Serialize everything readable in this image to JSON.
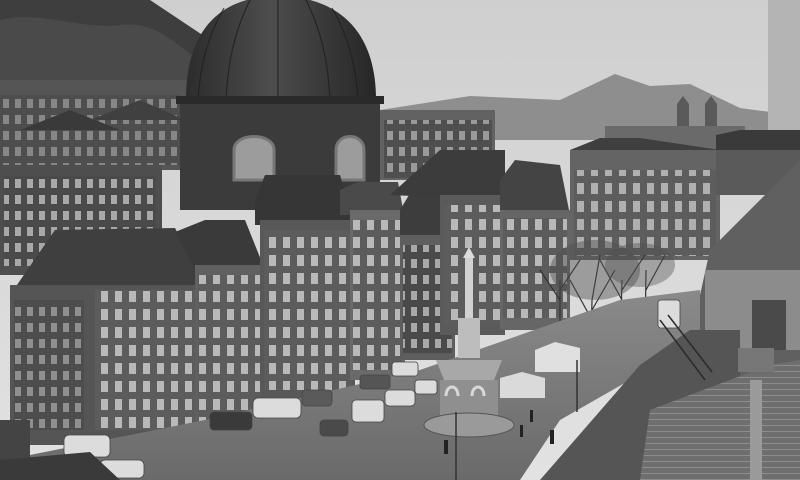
{
  "photo": {
    "style": "black-and-white",
    "palette": {
      "sky": "#d6d6d6",
      "far_hills": "#8e8e8e",
      "near_hills": "#4a4a4a",
      "dome": "#3a3a3a",
      "walls": "#5a5a5a",
      "roofs": "#3f3f3f",
      "pavement": "#7a7a7a",
      "windows": "#c8c8c8"
    },
    "regions": [
      "sky",
      "hills",
      "domed-church",
      "town-house-row",
      "fountain-column",
      "city-square",
      "parked-cars",
      "foreground-roofs"
    ]
  }
}
